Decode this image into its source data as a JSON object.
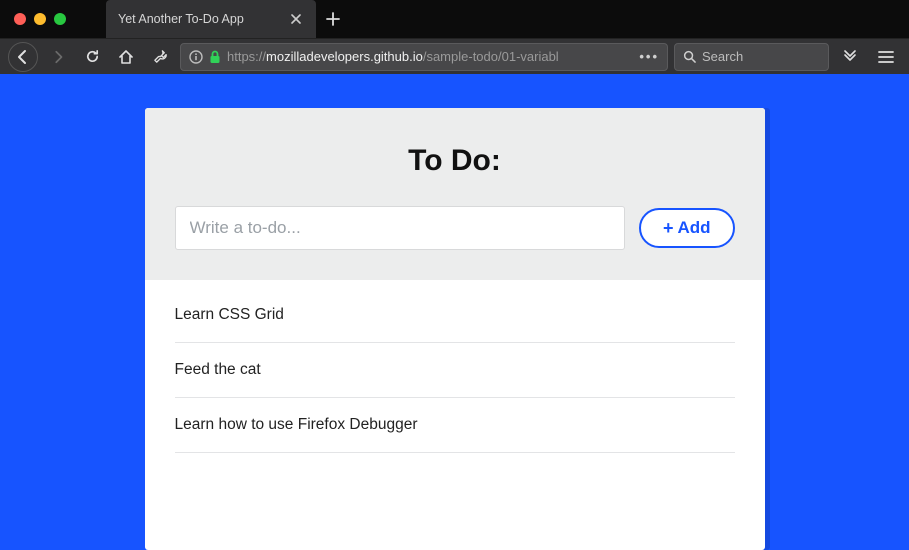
{
  "browser": {
    "tab_title": "Yet Another To-Do App",
    "url": {
      "protocol": "https://",
      "host": "mozilladevelopers.github.io",
      "path": "/sample-todo/01-variabl"
    },
    "search_placeholder": "Search"
  },
  "page": {
    "title": "To Do:",
    "input_placeholder": "Write a to-do...",
    "add_button_label": "Add",
    "todos": [
      {
        "text": "Learn CSS Grid"
      },
      {
        "text": "Feed the cat"
      },
      {
        "text": "Learn how to use Firefox Debugger"
      }
    ]
  },
  "colors": {
    "page_bg": "#1754ff",
    "accent": "#1754ff"
  }
}
